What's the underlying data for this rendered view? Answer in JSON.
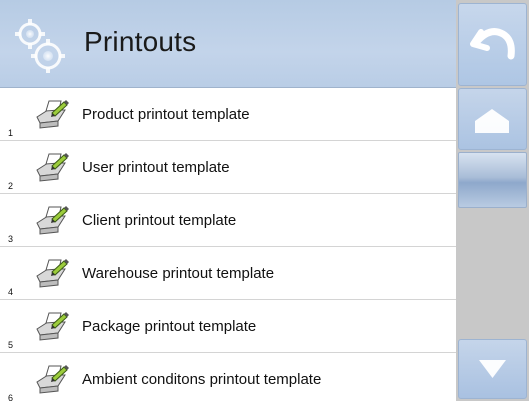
{
  "header": {
    "title": "Printouts",
    "icon": "gears-icon"
  },
  "list": {
    "items": [
      {
        "number": "1",
        "label": "Product printout template",
        "icon": "printer-pencil-icon"
      },
      {
        "number": "2",
        "label": "User printout template",
        "icon": "printer-pencil-icon"
      },
      {
        "number": "3",
        "label": "Client printout template",
        "icon": "printer-pencil-icon"
      },
      {
        "number": "4",
        "label": "Warehouse printout template",
        "icon": "printer-pencil-icon"
      },
      {
        "number": "5",
        "label": "Package printout template",
        "icon": "printer-pencil-icon"
      },
      {
        "number": "6",
        "label": "Ambient conditons printout template",
        "icon": "printer-pencil-icon"
      }
    ]
  },
  "side_panel": {
    "back_icon": "undo-arrow-icon",
    "home_icon": "home-icon",
    "scroll_down_icon": "arrow-down-icon"
  },
  "colors": {
    "header_bg": "#bfd1e8",
    "panel_bg": "#c8c8c8",
    "button_bg": "#b5cae6"
  }
}
